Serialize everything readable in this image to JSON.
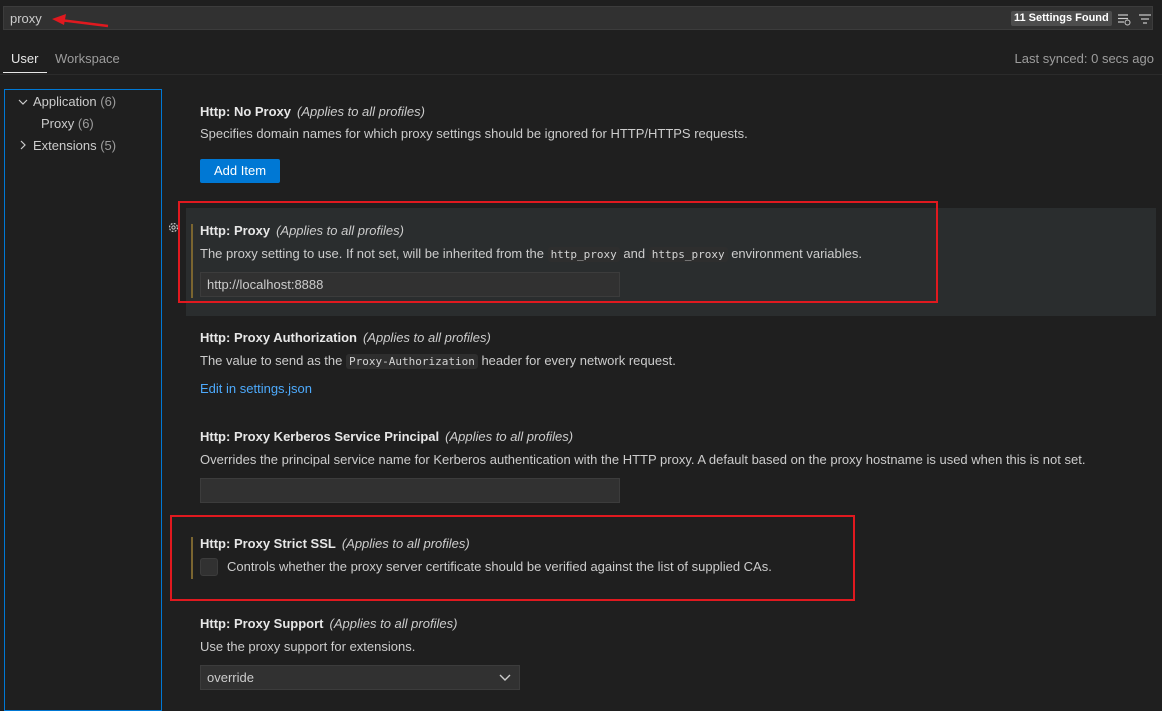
{
  "search": {
    "value": "proxy",
    "results_badge": "11 Settings Found"
  },
  "tabs": [
    {
      "label": "User",
      "active": true
    },
    {
      "label": "Workspace",
      "active": false
    }
  ],
  "sync_status": "Last synced: 0 secs ago",
  "toc": {
    "items": [
      {
        "label": "Application",
        "count": "(6)",
        "expanded": true
      },
      {
        "label": "Proxy",
        "count": "(6)"
      },
      {
        "label": "Extensions",
        "count": "(5)",
        "expanded": false
      }
    ]
  },
  "settings": {
    "no_proxy": {
      "category": "Http: ",
      "name": "No Proxy",
      "scope": "(Applies to all profiles)",
      "description": "Specifies domain names for which proxy settings should be ignored for HTTP/HTTPS requests.",
      "button": "Add Item"
    },
    "proxy": {
      "category": "Http: ",
      "name": "Proxy",
      "scope": "(Applies to all profiles)",
      "desc_before": "The proxy setting to use. If not set, will be inherited from the ",
      "code1": "http_proxy",
      "desc_mid": " and ",
      "code2": "https_proxy",
      "desc_after": " environment variables.",
      "value": "http://localhost:8888"
    },
    "proxy_authorization": {
      "category": "Http: ",
      "name": "Proxy Authorization",
      "scope": "(Applies to all profiles)",
      "desc_before": "The value to send as the ",
      "code": "Proxy-Authorization",
      "desc_after": " header for every network request.",
      "link": "Edit in settings.json"
    },
    "proxy_kerberos": {
      "category": "Http: ",
      "name": "Proxy Kerberos Service Principal",
      "scope": "(Applies to all profiles)",
      "description": "Overrides the principal service name for Kerberos authentication with the HTTP proxy. A default based on the proxy hostname is used when this is not set.",
      "value": ""
    },
    "proxy_strict_ssl": {
      "category": "Http: ",
      "name": "Proxy Strict SSL",
      "scope": "(Applies to all profiles)",
      "description": "Controls whether the proxy server certificate should be verified against the list of supplied CAs.",
      "checked": false
    },
    "proxy_support": {
      "category": "Http: ",
      "name": "Proxy Support",
      "scope": "(Applies to all profiles)",
      "description": "Use the proxy support for extensions.",
      "value": "override"
    }
  },
  "colors": {
    "accent": "#0078d4",
    "highlight_box": "#e0191f",
    "link": "#4daafc",
    "modified_bar": "#7a6530"
  }
}
